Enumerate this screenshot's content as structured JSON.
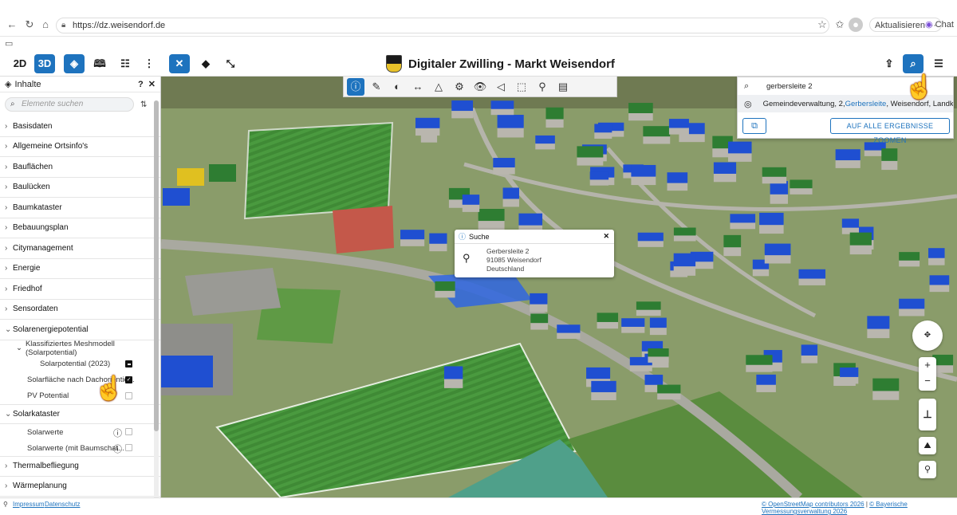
{
  "browser": {
    "url": "https://dz.weisendorf.de",
    "update_label": "Aktualisieren",
    "chat_label": "Chat"
  },
  "toolbar": {
    "btn_2d": "2D",
    "btn_3d": "3D",
    "title": "Digitaler Zwilling - Markt Weisendorf"
  },
  "sidebar": {
    "title": "Inhalte",
    "search_placeholder": "Elemente suchen",
    "items": [
      {
        "label": "Basisdaten"
      },
      {
        "label": "Allgemeine Ortsinfo's"
      },
      {
        "label": "Bauflächen"
      },
      {
        "label": "Baulücken"
      },
      {
        "label": "Baumkataster"
      },
      {
        "label": "Bebauungsplan"
      },
      {
        "label": "Citymanagement"
      },
      {
        "label": "Energie"
      },
      {
        "label": "Friedhof"
      },
      {
        "label": "Sensordaten"
      },
      {
        "label": "Solarenergiepotential"
      }
    ],
    "solar_group": "Klassifiziertes Meshmodell (Solarpotential)",
    "solar_layers": [
      {
        "label": "Solarpotential (2023)",
        "state": "mixed"
      },
      {
        "label": "Solarfläche nach Dachorientie...",
        "state": "checked"
      },
      {
        "label": "PV Potential",
        "state": "unchecked"
      }
    ],
    "kataster": "Solarkataster",
    "kataster_layers": [
      {
        "label": "Solarwerte"
      },
      {
        "label": "Solarwerte (mit Baumschat..."
      }
    ],
    "bottom_items": [
      {
        "label": "Thermalbefliegung"
      },
      {
        "label": "Wärmeplanung"
      }
    ]
  },
  "search": {
    "query": "gerbersleite 2",
    "result_prefix": "Gemeindeverwaltung, 2, ",
    "result_highlight": "Gerbersleite",
    "result_suffix": ", Weisendorf, Landkreis E...",
    "zoom_all_label": "AUF ALLE ERGEBNISSE ZOOMEN"
  },
  "popup": {
    "title": "Suche",
    "street": "Gerbersleite 2",
    "city": "91085 Weisendorf",
    "country": "Deutschland"
  },
  "footer": {
    "impressum": "Impressum",
    "datenschutz": "Datenschutz",
    "osm": "© OpenStreetMap contributors 2026",
    "bvv": "© Bayerische Vermessungsverwaltung 2026"
  },
  "colors": {
    "accent": "#1e73be",
    "roof_blue": "#1f4fd1",
    "roof_green": "#2e7d32",
    "roof_yellow": "#e0c020"
  }
}
